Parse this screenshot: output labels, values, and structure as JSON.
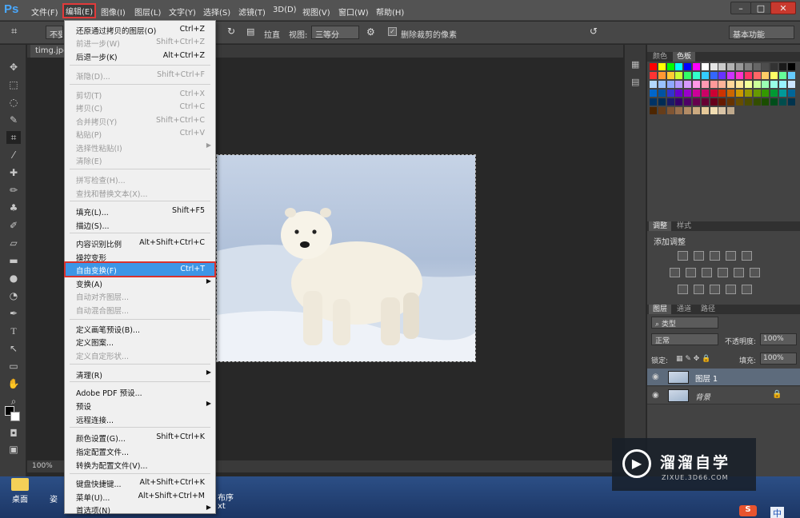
{
  "app": {
    "logo": "Ps"
  },
  "menubar": {
    "items": [
      "文件(F)",
      "编辑(E)",
      "图像(I)",
      "图层(L)",
      "文字(Y)",
      "选择(S)",
      "滤镜(T)",
      "3D(D)",
      "视图(V)",
      "窗口(W)",
      "帮助(H)"
    ],
    "active": "编辑(E)"
  },
  "window": {
    "min": "–",
    "max": "□",
    "close": "✕"
  },
  "options": {
    "crop_preset": "不受",
    "straighten": "拉直",
    "view_label": "视图:",
    "view_value": "三等分",
    "delete_crop": "删除裁剪的像素",
    "workspace": "基本功能"
  },
  "document": {
    "tab": "timg.jpg",
    "zoom": "100%"
  },
  "edit_menu": {
    "items": [
      {
        "label": "还原通过拷贝的图层(O)",
        "shortcut": "Ctrl+Z"
      },
      {
        "label": "前进一步(W)",
        "shortcut": "Shift+Ctrl+Z"
      },
      {
        "label": "后退一步(K)",
        "shortcut": "Alt+Ctrl+Z"
      },
      {
        "label": "渐隐(D)...",
        "shortcut": "Shift+Ctrl+F"
      },
      {
        "label": "剪切(T)",
        "shortcut": "Ctrl+X"
      },
      {
        "label": "拷贝(C)",
        "shortcut": "Ctrl+C"
      },
      {
        "label": "合并拷贝(Y)",
        "shortcut": "Shift+Ctrl+C"
      },
      {
        "label": "粘贴(P)",
        "shortcut": "Ctrl+V"
      },
      {
        "label": "选择性粘贴(I)",
        "shortcut": ""
      },
      {
        "label": "清除(E)",
        "shortcut": ""
      },
      {
        "label": "拼写检查(H)...",
        "shortcut": ""
      },
      {
        "label": "查找和替换文本(X)...",
        "shortcut": ""
      },
      {
        "label": "填充(L)...",
        "shortcut": "Shift+F5"
      },
      {
        "label": "描边(S)...",
        "shortcut": ""
      },
      {
        "label": "内容识别比例",
        "shortcut": "Alt+Shift+Ctrl+C"
      },
      {
        "label": "操控变形",
        "shortcut": ""
      },
      {
        "label": "自由变换(F)",
        "shortcut": "Ctrl+T"
      },
      {
        "label": "变换(A)",
        "shortcut": ""
      },
      {
        "label": "自动对齐图层...",
        "shortcut": ""
      },
      {
        "label": "自动混合图层...",
        "shortcut": ""
      },
      {
        "label": "定义画笔预设(B)...",
        "shortcut": ""
      },
      {
        "label": "定义图案...",
        "shortcut": ""
      },
      {
        "label": "定义自定形状...",
        "shortcut": ""
      },
      {
        "label": "清理(R)",
        "shortcut": ""
      },
      {
        "label": "Adobe PDF 预设...",
        "shortcut": ""
      },
      {
        "label": "预设",
        "shortcut": ""
      },
      {
        "label": "远程连接...",
        "shortcut": ""
      },
      {
        "label": "颜色设置(G)...",
        "shortcut": "Shift+Ctrl+K"
      },
      {
        "label": "指定配置文件...",
        "shortcut": ""
      },
      {
        "label": "转换为配置文件(V)...",
        "shortcut": ""
      },
      {
        "label": "键盘快捷键...",
        "shortcut": "Alt+Shift+Ctrl+K"
      },
      {
        "label": "菜单(U)...",
        "shortcut": "Alt+Shift+Ctrl+M"
      },
      {
        "label": "首选项(N)",
        "shortcut": ""
      }
    ]
  },
  "panels": {
    "swatch_tabs": [
      "颜色",
      "色板"
    ],
    "adjust_tabs": [
      "调整",
      "样式"
    ],
    "adjust_title": "添加调整",
    "layers_tabs": [
      "图层",
      "通道",
      "路径"
    ],
    "kind": "类型",
    "blend_mode": "正常",
    "opacity_label": "不透明度:",
    "opacity_value": "100%",
    "lock_label": "锁定:",
    "fill_label": "填充:",
    "fill_value": "100%",
    "layers": [
      {
        "name": "图层 1"
      },
      {
        "name": "背景"
      }
    ]
  },
  "watermark": {
    "title": "溜溜自学",
    "url": "ZIXUE.3D66.COM"
  },
  "taskbar": {
    "desktop": "桌面",
    "frag1": "姿",
    "frag2": "布序",
    "frag3": "xt",
    "ime": "中"
  }
}
